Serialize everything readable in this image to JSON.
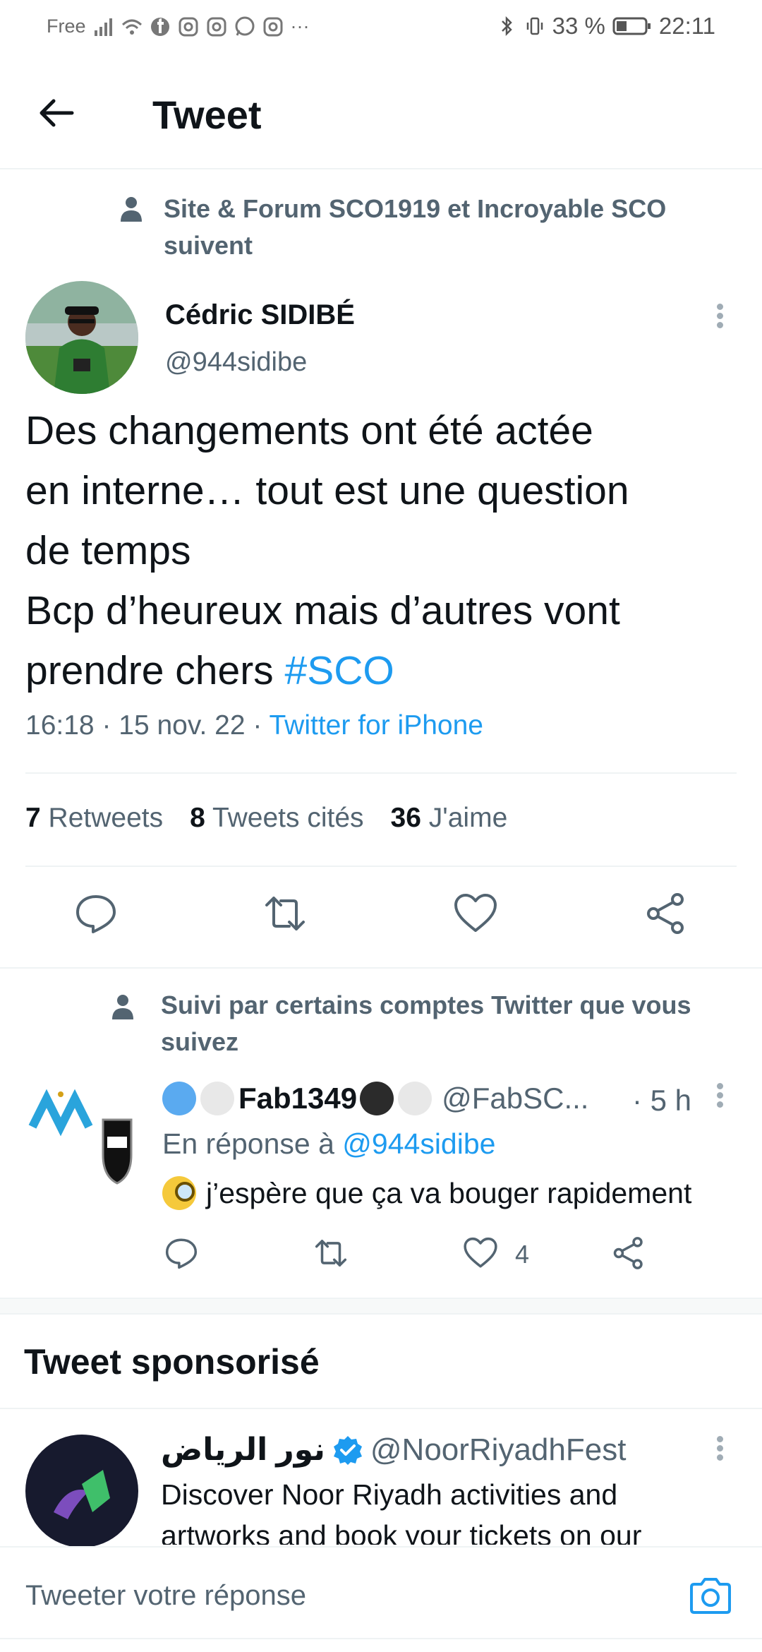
{
  "status_bar": {
    "carrier": "Free",
    "more": "···",
    "battery": "33 %",
    "time": "22:11"
  },
  "header": {
    "title": "Tweet"
  },
  "main_tweet": {
    "social_context": "Site & Forum SCO1919 et Incroyable SCO suivent",
    "author_name": "Cédric SIDIBÉ",
    "author_handle": "@944sidibe",
    "text_lines": [
      "Des changements ont été actée",
      "en interne… tout est une question",
      "de temps",
      "Bcp d’heureux mais d’autres vont",
      "prendre chers "
    ],
    "hashtag": "#SCO",
    "time": "16:18",
    "date": "15 nov. 22",
    "source": "Twitter for iPhone",
    "stats": {
      "retweets_count": "7",
      "retweets_label": "Retweets",
      "quotes_count": "8",
      "quotes_label": "Tweets cités",
      "likes_count": "36",
      "likes_label": "J'aime"
    }
  },
  "reply": {
    "social_context": "Suivi par certains comptes Twitter que vous suivez",
    "author_name": "Fab1349",
    "author_handle": "@FabSC...",
    "time": "· 5 h",
    "reply_to_prefix": "En réponse à ",
    "reply_to_handle": "@944sidibe",
    "text": "j’espère que ça va bouger rapidement",
    "like_count": "4"
  },
  "sponsored": {
    "section_title": "Tweet sponsorisé",
    "author_name": "نور الرياض",
    "author_handle": "@NoorRiyadhFest",
    "text": "Discover Noor Riyadh activities and artworks and book your tickets on our"
  },
  "compose": {
    "placeholder": "Tweeter votre réponse"
  },
  "colors": {
    "accent": "#1d9bf0",
    "secondary_text": "#536471",
    "primary_text": "#0f1419"
  }
}
